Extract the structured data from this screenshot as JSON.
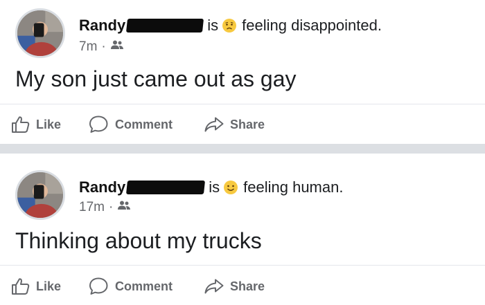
{
  "posts": [
    {
      "author": "Randy",
      "verb": "is",
      "feeling_emoji": "disappointed-face",
      "feeling": "feeling disappointed.",
      "time": "7m",
      "audience_icon": "friends-icon",
      "text": "My son just came out as gay",
      "actions": {
        "like": "Like",
        "comment": "Comment",
        "share": "Share"
      }
    },
    {
      "author": "Randy",
      "verb": "is",
      "feeling_emoji": "smiling-face",
      "feeling": "feeling human.",
      "time": "17m",
      "audience_icon": "friends-icon",
      "text": "Thinking about my trucks",
      "actions": {
        "like": "Like",
        "comment": "Comment",
        "share": "Share"
      }
    }
  ],
  "separator_dot": "·",
  "colors": {
    "emoji": "#f7c940",
    "muted": "#65676b",
    "separator": "#dcdfe3",
    "text": "#1c1e21"
  }
}
